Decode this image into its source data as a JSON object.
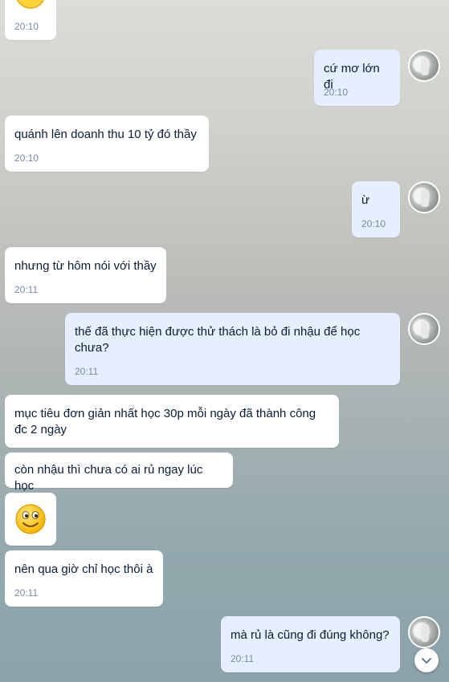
{
  "messages": [
    {
      "id": "m0",
      "side": "in",
      "type": "emoji",
      "time": "20:10"
    },
    {
      "id": "m1",
      "side": "out",
      "text": "cứ mơ lớn đi",
      "time": "20:10"
    },
    {
      "id": "m2",
      "side": "in",
      "text": "quánh lên doanh thu 10 tỷ đó thầy",
      "time": "20:10"
    },
    {
      "id": "m3",
      "side": "out",
      "text": "ừ",
      "time": "20:10"
    },
    {
      "id": "m4",
      "side": "in",
      "text": "nhưng từ hôm nói với thầy",
      "time": "20:11"
    },
    {
      "id": "m5",
      "side": "out",
      "text": "thế đã thực hiện được thử thách là bỏ đi nhậu để học chưa?",
      "time": "20:11"
    },
    {
      "id": "m6",
      "side": "in",
      "text": "mục tiêu đơn giản nhất học 30p mỗi ngày đã thành công đc 2 ngày"
    },
    {
      "id": "m7",
      "side": "in",
      "text": "còn nhậu thì chưa có ai rủ ngay lúc học"
    },
    {
      "id": "m8",
      "side": "in",
      "type": "emoji"
    },
    {
      "id": "m9",
      "side": "in",
      "text": "nên qua giờ chỉ học thôi à",
      "time": "20:11"
    },
    {
      "id": "m10",
      "side": "out",
      "text": "mà rủ là cũng đi đúng không?",
      "time": "20:11"
    }
  ],
  "icons": {
    "emoji": "smiley-face",
    "scroll": "chevron-down",
    "avatar": "contact-avatar"
  },
  "colors": {
    "incoming_bubble": "#ffffff",
    "outgoing_bubble": "#e5efff",
    "text": "#081c36",
    "time": "#7589a3"
  }
}
